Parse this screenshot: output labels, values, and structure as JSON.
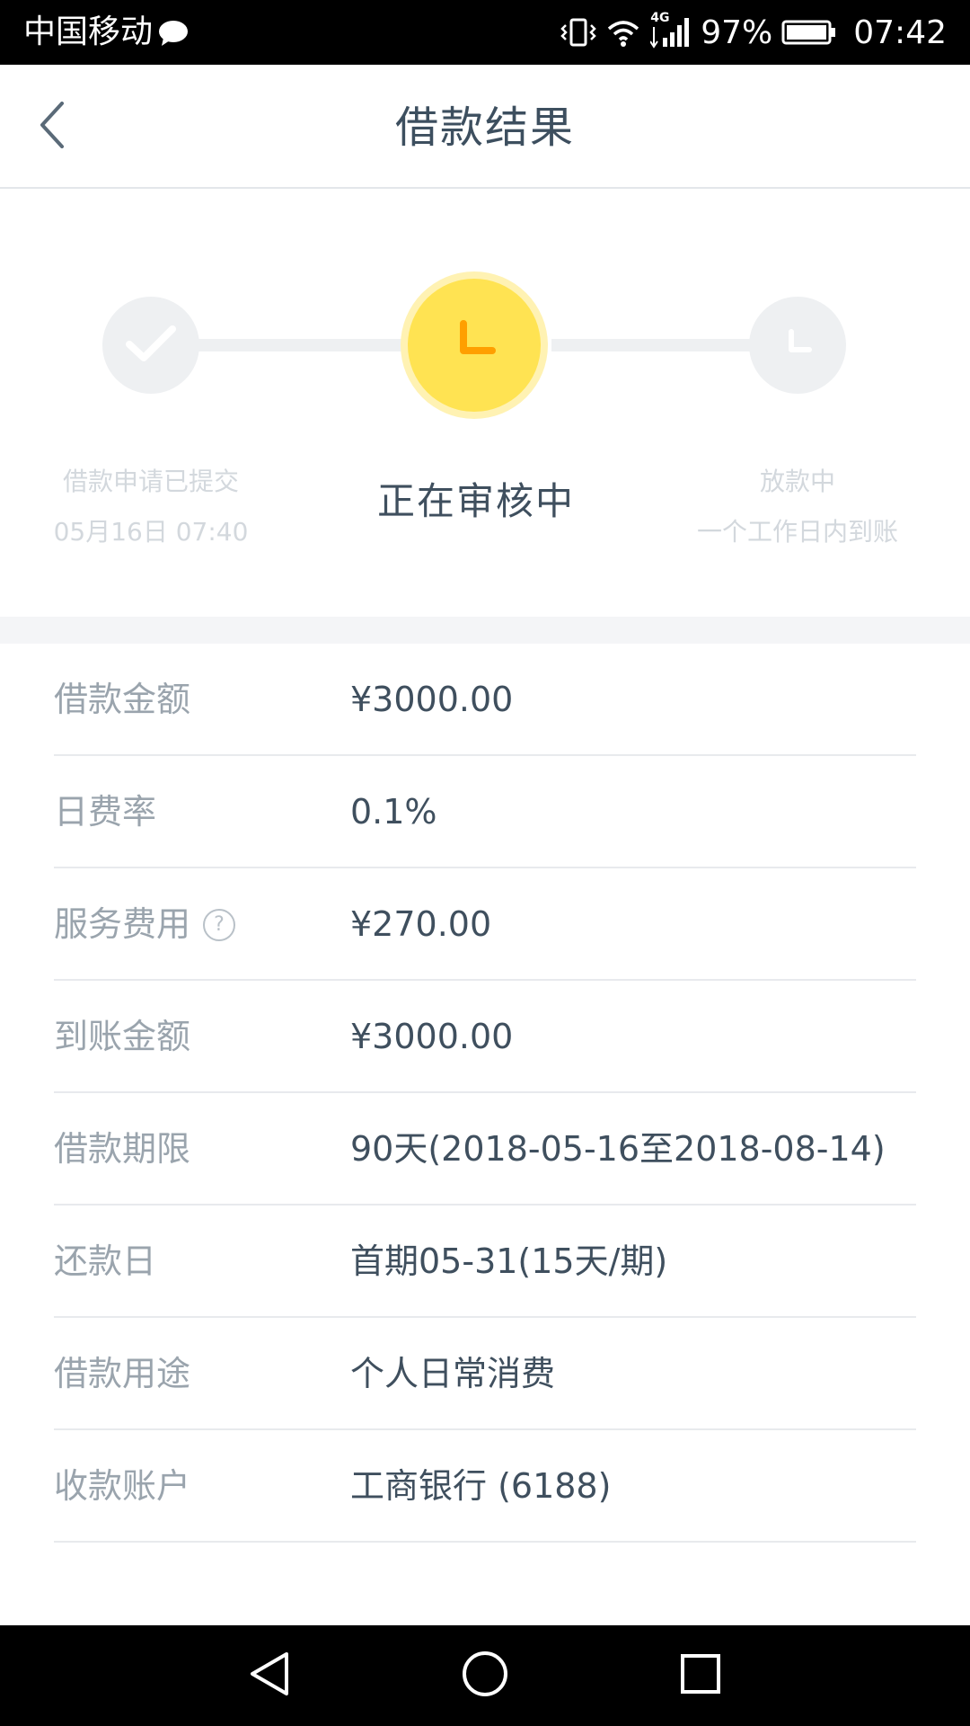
{
  "status_bar": {
    "carrier": "中国移动",
    "network": "4G",
    "battery": "97%",
    "time": "07:42"
  },
  "header": {
    "title": "借款结果"
  },
  "steps": {
    "step1_title": "借款申请已提交",
    "step1_time": "05月16日 07:40",
    "step2_title": "正在审核中",
    "step3_title": "放款中",
    "step3_desc": "一个工作日内到账"
  },
  "details": {
    "rows": [
      {
        "label": "借款金额",
        "value": "¥3000.00"
      },
      {
        "label": "日费率",
        "value": "0.1%"
      },
      {
        "label": "服务费用",
        "value": "¥270.00"
      },
      {
        "label": "到账金额",
        "value": "¥3000.00"
      },
      {
        "label": "借款期限",
        "value": "90天(2018-05-16至2018-08-14)"
      },
      {
        "label": "还款日",
        "value": "首期05-31(15天/期)"
      },
      {
        "label": "借款用途",
        "value": "个人日常消费"
      },
      {
        "label": "收款账户",
        "value": "工商银行 (6188)"
      }
    ],
    "help_symbol": "?"
  },
  "colors": {
    "accent_yellow": "#ffe352",
    "accent_orange": "#ff9f00",
    "muted_gray": "#eef0f2"
  }
}
